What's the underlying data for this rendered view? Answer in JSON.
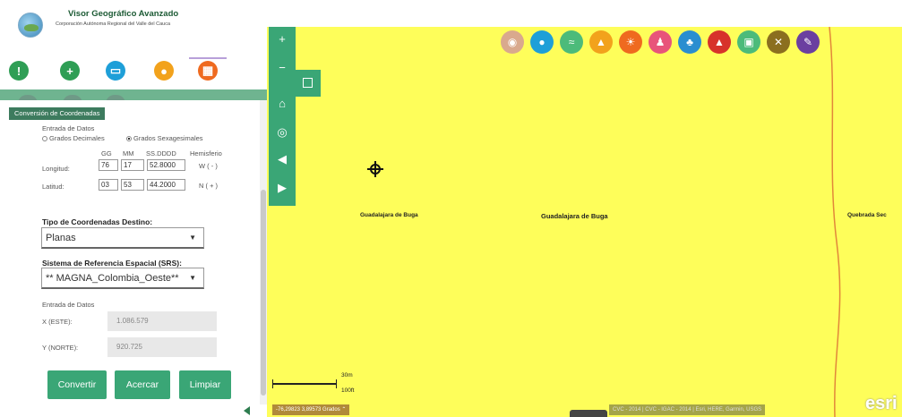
{
  "header": {
    "title": "Visor Geográfico Avanzado",
    "subtitle": "Corporación Autónoma Regional del Valle del Cauca"
  },
  "toolbar": {
    "tools": [
      {
        "name": "info-icon",
        "glyph": "!",
        "color": "#2f9e55"
      },
      {
        "name": "plus-icon",
        "glyph": "+",
        "color": "#2f9e55"
      },
      {
        "name": "ruler-icon",
        "glyph": "▭",
        "color": "#1e9fd8"
      },
      {
        "name": "pin-icon",
        "glyph": "●",
        "color": "#f2a21c"
      },
      {
        "name": "calculator-icon",
        "glyph": "▦",
        "color": "#ef6a1f"
      }
    ]
  },
  "panel": {
    "tab_label": "Conversión de Coordenadas",
    "input": {
      "heading": "Entrada de Datos",
      "radio_decimal": "Grados Decimales",
      "radio_sexagesimal": "Grados Sexagesimales",
      "col_gg": "GG",
      "col_mm": "MM",
      "col_ss": "SS.DDDD",
      "col_hemi": "Hemisferio",
      "longitud_label": "Longitud:",
      "longitud_gg": "76",
      "longitud_mm": "17",
      "longitud_ss": "52.8000",
      "longitud_hemi": "W ( - )",
      "latitud_label": "Latitud:",
      "latitud_gg": "03",
      "latitud_mm": "53",
      "latitud_ss": "44.2000",
      "latitud_hemi": "N ( + )"
    },
    "dest_type_label": "Tipo de Coordenadas Destino:",
    "dest_type_value": "Planas",
    "srs_label": "Sistema de Referencia Espacial (SRS):",
    "srs_value": "** MAGNA_Colombia_Oeste**",
    "output": {
      "heading": "Entrada de Datos",
      "x_label": "X (ESTE):",
      "x_value": "1.086.579",
      "y_label": "Y (NORTE):",
      "y_value": "920.725"
    },
    "buttons": {
      "convert": "Convertir",
      "zoom": "Acercar",
      "clear": "Limpiar"
    }
  },
  "map": {
    "places": {
      "p1": "Guadalajara de Buga",
      "p2": "Guadalajara de Buga",
      "p3": "Quebrada Sec"
    },
    "scale_m": "30m",
    "scale_ft": "100ft",
    "coords": "-76,29823 3,89573 Grados",
    "attribution": "CVC - 2014 | CVC - IGAC - 2014 | Esri, HERE, Garmin, USGS",
    "esri": "esri",
    "layers": [
      {
        "name": "tan-pin-layer-icon",
        "glyph": "◉",
        "color": "#d9a98d"
      },
      {
        "name": "water-drop-layer-icon",
        "glyph": "●",
        "color": "#1e9fd8"
      },
      {
        "name": "wind-layer-icon",
        "glyph": "≈",
        "color": "#4cbb7a"
      },
      {
        "name": "animal-layer-icon",
        "glyph": "▲",
        "color": "#f2a21c"
      },
      {
        "name": "weather-layer-icon",
        "glyph": "☀",
        "color": "#ef6a1f"
      },
      {
        "name": "people-layer-icon",
        "glyph": "♟",
        "color": "#e8547a"
      },
      {
        "name": "plant-layer-icon",
        "glyph": "♣",
        "color": "#2a8ed0"
      },
      {
        "name": "mountain-layer-icon",
        "glyph": "▲",
        "color": "#d7322b"
      },
      {
        "name": "image-layer-icon",
        "glyph": "▣",
        "color": "#4cbb7a"
      },
      {
        "name": "tools-layer-icon",
        "glyph": "✕",
        "color": "#8b6f1f"
      },
      {
        "name": "brush-layer-icon",
        "glyph": "✎",
        "color": "#6b3fa0"
      }
    ]
  }
}
